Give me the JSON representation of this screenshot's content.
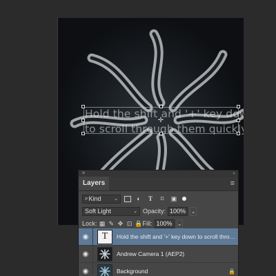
{
  "canvas": {
    "text_line1": "Hold the shift and '+' key down",
    "text_line2": "to scroll through them quickly"
  },
  "panel": {
    "tab_label": "Layers",
    "filter_kind": "Kind",
    "blend_mode": "Soft Light",
    "opacity_label": "Opacity:",
    "opacity_value": "100%",
    "lock_label": "Lock:",
    "fill_label": "Fill:",
    "fill_value": "100%",
    "layers": [
      {
        "name": "Hold the shift and '+' key down to scroll through the...",
        "kind": "type",
        "selected": true
      },
      {
        "name": "Andrew Camera 1 (AEP2)",
        "kind": "image",
        "selected": false
      },
      {
        "name": "Background",
        "kind": "background",
        "selected": false,
        "locked": true
      }
    ]
  },
  "colors": {
    "selection": "#5e7a96",
    "panel_bg": "#464646",
    "workspace_bg": "#2b2b2b"
  }
}
